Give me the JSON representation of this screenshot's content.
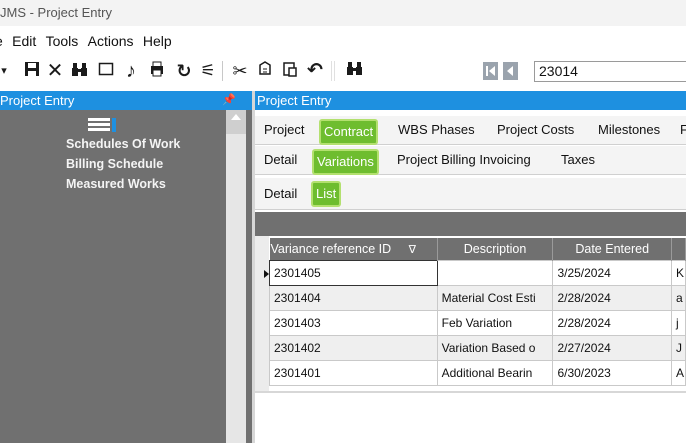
{
  "window": {
    "title": "JMS - Project Entry"
  },
  "menu": {
    "items": [
      "e",
      "Edit",
      "Tools",
      "Actions",
      "Help"
    ]
  },
  "toolbar": {
    "icons": [
      "dropdown-arrow-icon",
      "save-icon",
      "delete-icon",
      "binoculars-icon",
      "new-document-icon",
      "flag-icon",
      "print-icon",
      "refresh-icon",
      "wand-icon",
      "cut-icon",
      "copy-icon",
      "paste-icon",
      "undo-icon",
      "find-icon",
      "first-record-icon",
      "previous-record-icon"
    ],
    "search_value": "23014"
  },
  "left_panel": {
    "title": "Project Entry",
    "tree_items": [
      "Schedules Of Work",
      "Billing Schedule",
      "Measured Works"
    ]
  },
  "right_panel": {
    "title": "Project Entry",
    "main_tabs": [
      "Project",
      "Contract",
      "WBS Phases",
      "Project Costs",
      "Milestones",
      "F"
    ],
    "main_active": "Contract",
    "sub_tabs": [
      "Detail",
      "Variations",
      "Project Billing Invoicing",
      "Taxes"
    ],
    "sub_active": "Variations",
    "view_tabs": [
      "Detail",
      "List"
    ],
    "view_active": "List"
  },
  "grid": {
    "columns": [
      "Variance reference ID",
      "Description",
      "Date Entered",
      ""
    ],
    "rows": [
      [
        "2301405",
        "",
        "3/25/2024",
        "K"
      ],
      [
        "2301404",
        "Material Cost Esti",
        "2/28/2024",
        "a"
      ],
      [
        "2301403",
        "Feb Variation",
        "2/28/2024",
        "j"
      ],
      [
        "2301402",
        "Variation Based o",
        "2/27/2024",
        "J"
      ],
      [
        "2301401",
        "Additional Bearin",
        "6/30/2023",
        "A"
      ]
    ],
    "filter_glyph": "∇"
  },
  "colors": {
    "accent_blue": "#1e90e0",
    "active_tab_green": "#6ebd2f",
    "panel_grey": "#707070"
  }
}
